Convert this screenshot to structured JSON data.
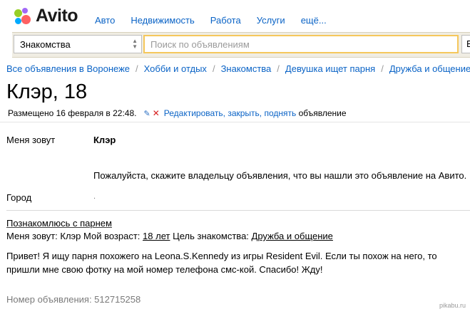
{
  "logo": {
    "text": "Avito"
  },
  "topnav": [
    "Авто",
    "Недвижимость",
    "Работа",
    "Услуги",
    "ещё..."
  ],
  "search": {
    "category": "Знакомства",
    "placeholder": "Поиск по объявлениям",
    "right_fragment": "В"
  },
  "breadcrumb": [
    "Все объявления в Воронеже",
    "Хобби и отдых",
    "Знакомства",
    "Девушка ищет парня",
    "Дружба и общение"
  ],
  "title": "Клэр, 18",
  "posted": {
    "text": "Размещено 16 февраля в 22:48.",
    "actions": "Редактировать, закрыть, поднять",
    "tail": "объявление"
  },
  "params": {
    "name_label": "Меня зовут",
    "name_value": "Клэр",
    "notice": "Пожалуйста, скажите владельцу объявления, что вы нашли это объявление на Авито.",
    "city_label": "Город",
    "city_value": "."
  },
  "description": {
    "title": "Познакомлюсь с парнем",
    "meta_prefix": "Меня зовут: Клэр Мой возраст:",
    "age": "18 лет",
    "goal_label": "Цель знакомства:",
    "goal": "Дружба и общение",
    "body": "Привет! Я ищу парня похожего на Leona.S.Kennedy из игры Resident Evil. Если ты похож на него, то пришли мне свою фотку на мой номер телефона смс-кой. Спасибо! Жду!"
  },
  "ad_number": "Номер объявления: 512715258",
  "watermark": "pikabu.ru",
  "colors": {
    "link": "#0a63c6",
    "search_border": "#f5c75b"
  }
}
